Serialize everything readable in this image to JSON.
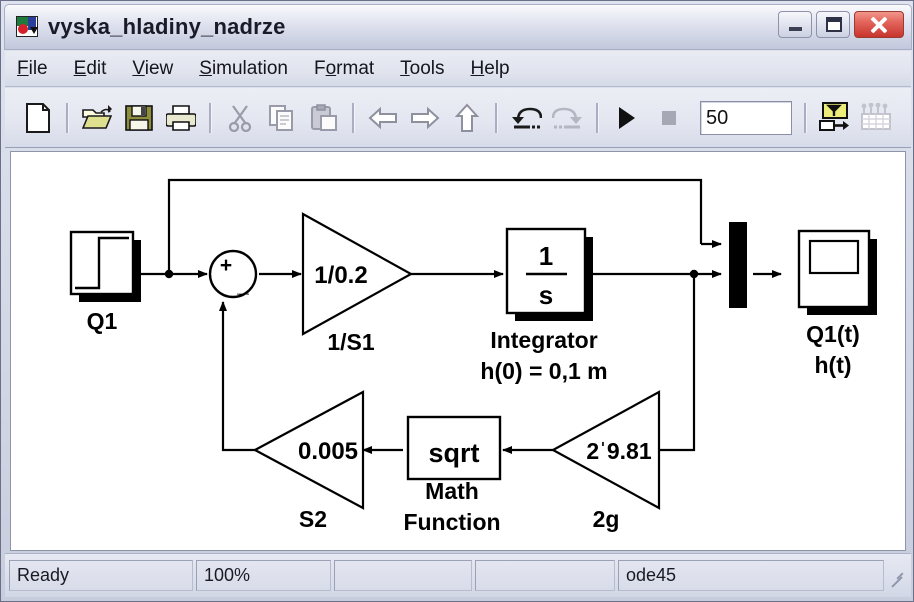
{
  "window": {
    "title": "vyska_hladiny_nadrze",
    "app_icon": "simulink-icon",
    "minimize_label": "–",
    "maximize_label": "□",
    "close_label": "✕"
  },
  "menu": {
    "items": [
      {
        "mnemonic": "F",
        "rest": "ile"
      },
      {
        "mnemonic": "E",
        "rest": "dit"
      },
      {
        "mnemonic": "V",
        "rest": "iew"
      },
      {
        "mnemonic": "S",
        "rest": "imulation"
      },
      {
        "mnemonic": "F",
        "rest": "ormat",
        "pre": ""
      },
      {
        "mnemonic": "T",
        "rest": "ools"
      },
      {
        "mnemonic": "H",
        "rest": "elp"
      }
    ],
    "labels": [
      "File",
      "Edit",
      "View",
      "Simulation",
      "Format",
      "Tools",
      "Help"
    ]
  },
  "toolbar": {
    "buttons": [
      "new-icon",
      "open-icon",
      "save-icon",
      "print-icon",
      "cut-icon",
      "copy-icon",
      "paste-icon",
      "back-icon",
      "forward-icon",
      "up-icon",
      "undo-icon",
      "redo-icon",
      "start-simulation-icon",
      "stop-simulation-icon"
    ],
    "simulation_stop_time": "50",
    "update_diagram_icon": "update-diagram-icon",
    "build_icon": "build-model-icon"
  },
  "statusbar": {
    "status": "Ready",
    "zoom": "100%",
    "cell3": "",
    "cell4": "",
    "solver": "ode45"
  },
  "diagram": {
    "blocks": {
      "step_source": {
        "name": "Q1",
        "type": "step"
      },
      "sum": {
        "plus": "+",
        "minus": "_",
        "type": "sum"
      },
      "gain_in": {
        "value": "1/0.2",
        "name": "1/S1",
        "type": "gain"
      },
      "integrator": {
        "numerator": "1",
        "denominator": "s",
        "name_line1": "Integrator",
        "name_line2": "h(0) = 0,1 m",
        "type": "integrator"
      },
      "mux": {
        "type": "mux"
      },
      "scope": {
        "name_line1": "Q1(t)",
        "name_line2": "h(t)",
        "type": "scope"
      },
      "gain_s2": {
        "value": "0.005",
        "name": "S2",
        "type": "gain"
      },
      "math_function": {
        "value": "sqrt",
        "name_line1": "Math",
        "name_line2": "Function",
        "type": "math"
      },
      "gain_2g": {
        "value": "2ˈ9.81",
        "name": "2g",
        "type": "gain"
      }
    }
  }
}
